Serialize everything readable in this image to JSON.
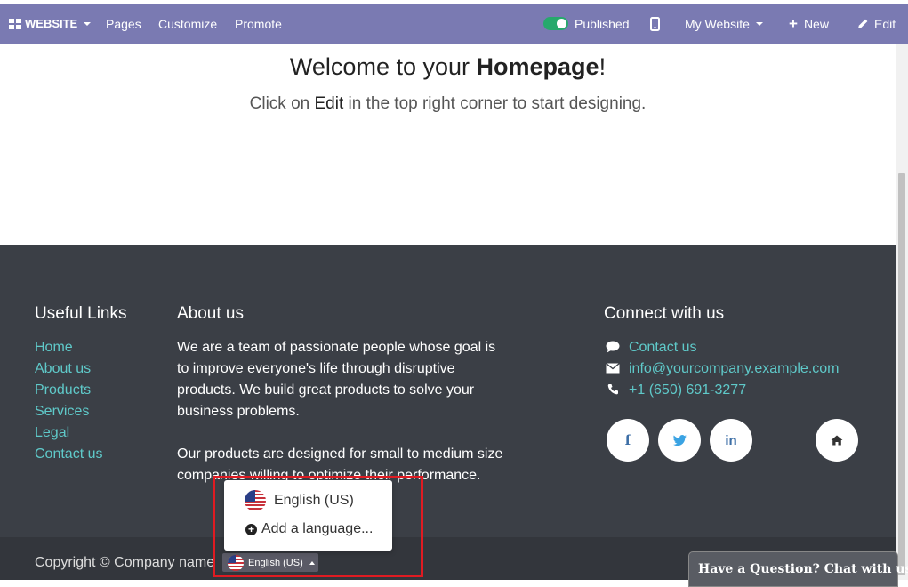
{
  "navbar": {
    "website_label": "WEBSITE",
    "pages_label": "Pages",
    "customize_label": "Customize",
    "promote_label": "Promote",
    "published_label": "Published",
    "site_label": "My Website",
    "new_label": "New",
    "edit_label": "Edit",
    "icons": [
      "apps-grid-icon",
      "mobile-icon",
      "plus-icon",
      "pencil-icon"
    ],
    "colors": {
      "bar": "#7a7ab2",
      "toggle_on": "#26a96c"
    }
  },
  "hero": {
    "title_prefix": "Welcome to your ",
    "title_bold": "Homepage",
    "title_suffix": "!",
    "sub_prefix": "Click on ",
    "sub_em": "Edit",
    "sub_suffix": " in the top right corner to start designing."
  },
  "footer": {
    "useful_links": {
      "heading": "Useful Links",
      "items": [
        "Home",
        "About us",
        "Products",
        "Services",
        "Legal",
        "Contact us"
      ]
    },
    "about": {
      "heading": "About us",
      "lines_p1": [
        "We are a team of passionate people whose goal is",
        "to improve everyone's life through disruptive",
        "products. We build great products to solve your",
        "business problems."
      ],
      "lines_p2": [
        "Our products are designed for small to medium size",
        "companies willing to optimize their performance."
      ]
    },
    "connect": {
      "heading": "Connect with us",
      "contact_label": "Contact us",
      "email": "info@yourcompany.example.com",
      "phone": "+1 (650) 691-3277",
      "icons": [
        "comment-icon",
        "envelope-icon",
        "phone-icon"
      ],
      "social_glyphs": {
        "facebook": "f",
        "twitter": "t",
        "linkedin": "in",
        "home": "⌂"
      }
    },
    "colors": {
      "background": "#3b3f46",
      "link": "#5fc9c9"
    }
  },
  "copyright": {
    "text": "Copyright © Company name",
    "language_button": "English (US)"
  },
  "language_dropdown": {
    "current": "English (US)",
    "add_language": "Add a language..."
  },
  "chat": {
    "label": "Have a Question? Chat with us."
  }
}
